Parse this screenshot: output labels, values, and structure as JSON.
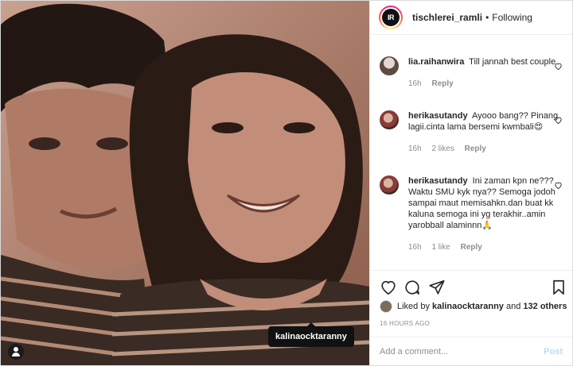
{
  "post": {
    "photo_tag": "kalinaocktaranny",
    "photo_description_icon": "user-tag-icon"
  },
  "header": {
    "avatar_text": "IR",
    "username": "tischlerei_ramli",
    "separator": "•",
    "follow_status": "Following"
  },
  "comments": [
    {
      "username": "lia.raihanwira",
      "text": "Till jannah best couple",
      "time": "16h",
      "likes": "",
      "reply": "Reply"
    },
    {
      "username": "herikasutandy",
      "text": "Ayooo bang?? Pinang lagii.cinta lama bersemi kwmbali😍",
      "time": "16h",
      "likes": "2 likes",
      "reply": "Reply"
    },
    {
      "username": "herikasutandy",
      "text": "Ini zaman kpn ne??? Waktu SMU kyk nya?? Semoga jodoh sampai maut memisahkn.dan buat kk kaluna semoga ini yg terakhir..amin yarobball alaminnn🙏",
      "time": "16h",
      "likes": "1 like",
      "reply": "Reply"
    }
  ],
  "likes": {
    "prefix": "Liked by",
    "user": "kalinaocktaranny",
    "and": "and",
    "others": "132 others"
  },
  "timestamp": "16 HOURS AGO",
  "composer": {
    "placeholder": "Add a comment...",
    "post_label": "Post"
  },
  "colors": {
    "text": "#262626",
    "muted": "#8e8e8e",
    "post_disabled": "#b2dffc",
    "border": "#efefef"
  }
}
